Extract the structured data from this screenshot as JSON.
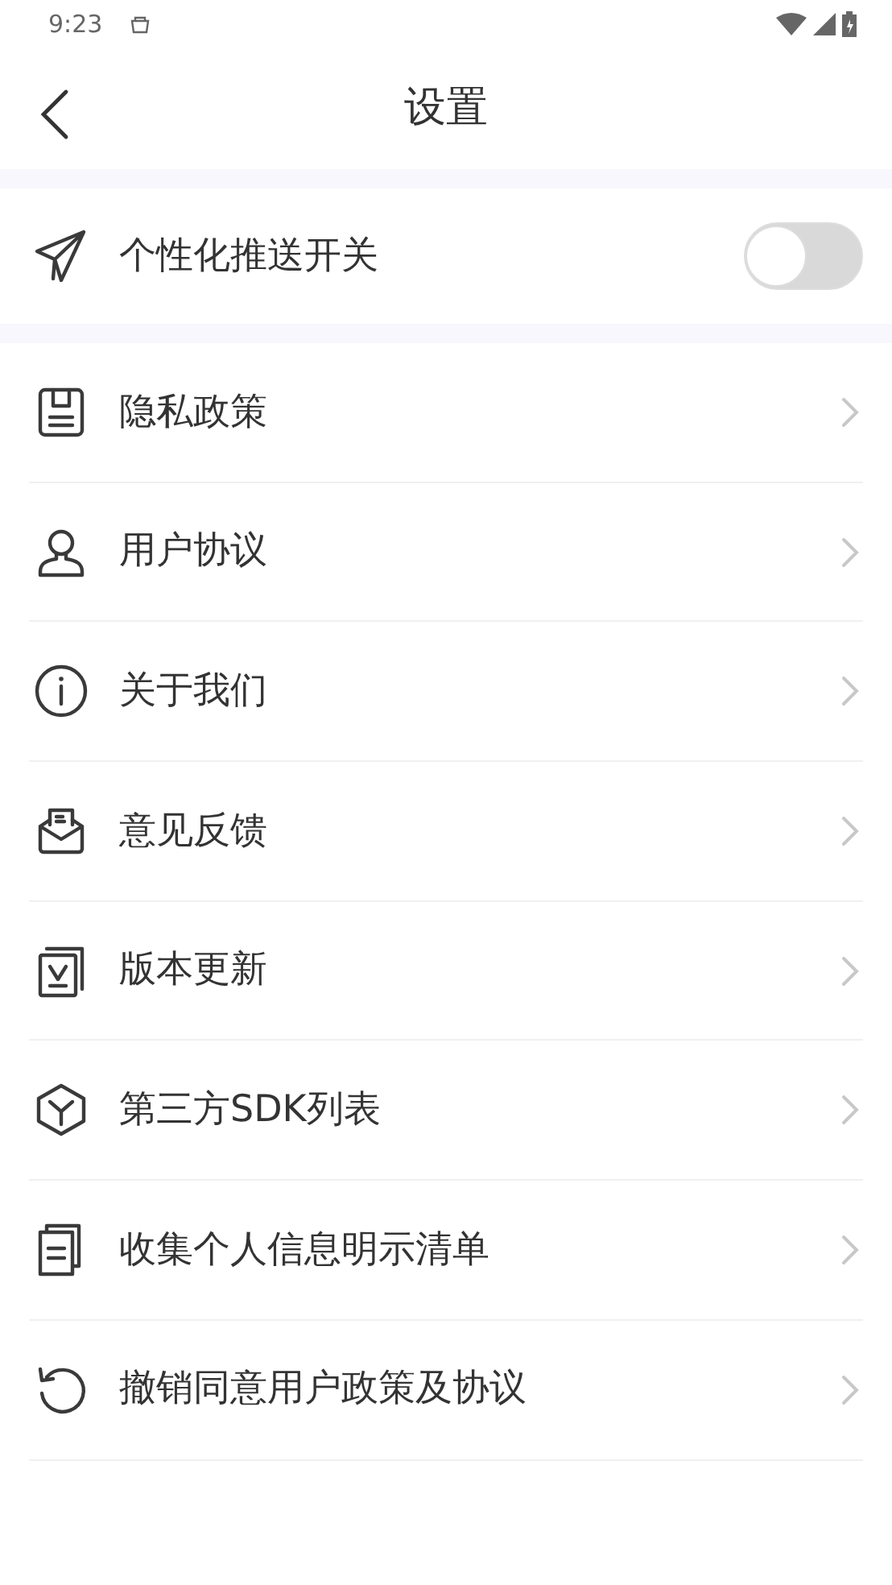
{
  "status_bar": {
    "time": "9:23"
  },
  "header": {
    "title": "设置"
  },
  "push_toggle": {
    "label": "个性化推送开关",
    "on": false
  },
  "menu": [
    {
      "label": "隐私政策"
    },
    {
      "label": "用户协议"
    },
    {
      "label": "关于我们"
    },
    {
      "label": "意见反馈"
    },
    {
      "label": "版本更新"
    },
    {
      "label": "第三方SDK列表"
    },
    {
      "label": "收集个人信息明示清单"
    },
    {
      "label": "撤销同意用户政策及协议"
    }
  ]
}
